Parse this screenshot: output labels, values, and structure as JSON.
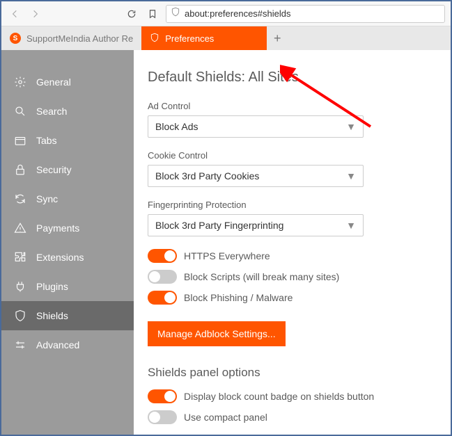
{
  "toolbar": {
    "url": "about:preferences#shields"
  },
  "tabs": {
    "bg_tab_label": "SupportMeIndia Author Re",
    "bg_tab_initial": "S",
    "active_tab_label": "Preferences"
  },
  "sidebar": {
    "items": [
      {
        "label": "General"
      },
      {
        "label": "Search"
      },
      {
        "label": "Tabs"
      },
      {
        "label": "Security"
      },
      {
        "label": "Sync"
      },
      {
        "label": "Payments"
      },
      {
        "label": "Extensions"
      },
      {
        "label": "Plugins"
      },
      {
        "label": "Shields"
      },
      {
        "label": "Advanced"
      }
    ]
  },
  "main": {
    "title": "Default Shields: All Sites",
    "ad_control": {
      "label": "Ad Control",
      "value": "Block Ads"
    },
    "cookie_control": {
      "label": "Cookie Control",
      "value": "Block 3rd Party Cookies"
    },
    "fingerprinting": {
      "label": "Fingerprinting Protection",
      "value": "Block 3rd Party Fingerprinting"
    },
    "toggles": {
      "https": "HTTPS Everywhere",
      "scripts": "Block Scripts (will break many sites)",
      "phishing": "Block Phishing / Malware"
    },
    "manage_btn": "Manage Adblock Settings...",
    "panel_title": "Shields panel options",
    "panel_toggles": {
      "badge": "Display block count badge on shields button",
      "compact": "Use compact panel"
    }
  }
}
